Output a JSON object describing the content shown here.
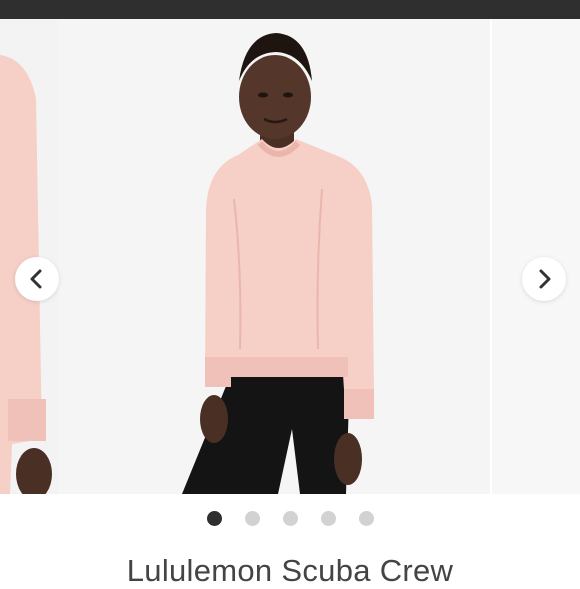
{
  "product": {
    "title": "Lululemon Scuba Crew",
    "garment_color": "#f6cfc7",
    "photo_count": 5,
    "active_photo": 1
  },
  "carousel": {
    "prev_icon": "chevron-left-icon",
    "next_icon": "chevron-right-icon"
  },
  "colors": {
    "top_bar": "#2f2f2f",
    "dot_active": "#2f2f2f",
    "dot_inactive": "#d2d2d2"
  }
}
